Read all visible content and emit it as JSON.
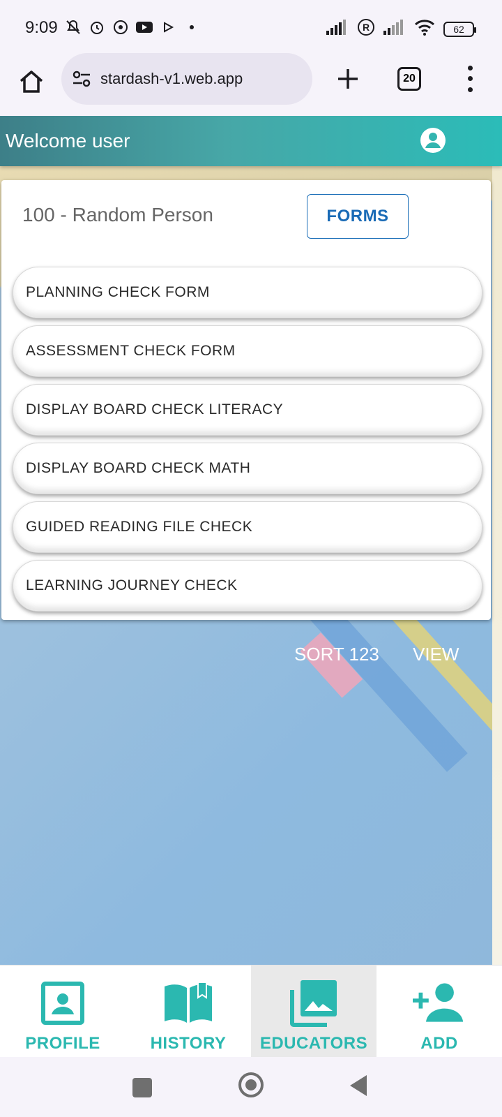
{
  "status_bar": {
    "time": "9:09",
    "battery": "62",
    "icons": [
      "mute-icon",
      "alarm-icon",
      "whatsapp-icon",
      "youtube-icon",
      "play-icon",
      "dot-icon",
      "signal-icon",
      "roaming-icon",
      "signal-icon",
      "wifi-icon",
      "battery-icon"
    ]
  },
  "browser": {
    "url": "stardash-v1.web.app",
    "tab_count": "20"
  },
  "app": {
    "header_title": "Welcome user"
  },
  "card": {
    "title": "100 - Random Person",
    "forms_button": "FORMS",
    "forms": [
      "PLANNING CHECK FORM",
      "ASSESSMENT CHECK FORM",
      "DISPLAY BOARD CHECK LITERACY",
      "DISPLAY BOARD CHECK MATH",
      "GUIDED READING FILE CHECK",
      "LEARNING JOURNEY CHECK"
    ]
  },
  "actions": {
    "sort_label": "SORT 123",
    "view_label": "VIEW"
  },
  "bottom_nav": {
    "items": [
      {
        "label": "PROFILE",
        "icon": "contact-card-icon"
      },
      {
        "label": "HISTORY",
        "icon": "book-icon"
      },
      {
        "label": "EDUCATORS",
        "icon": "photo-library-icon",
        "active": true
      },
      {
        "label": "ADD",
        "icon": "person-add-icon"
      }
    ],
    "accent_color": "#2bb8b0"
  }
}
